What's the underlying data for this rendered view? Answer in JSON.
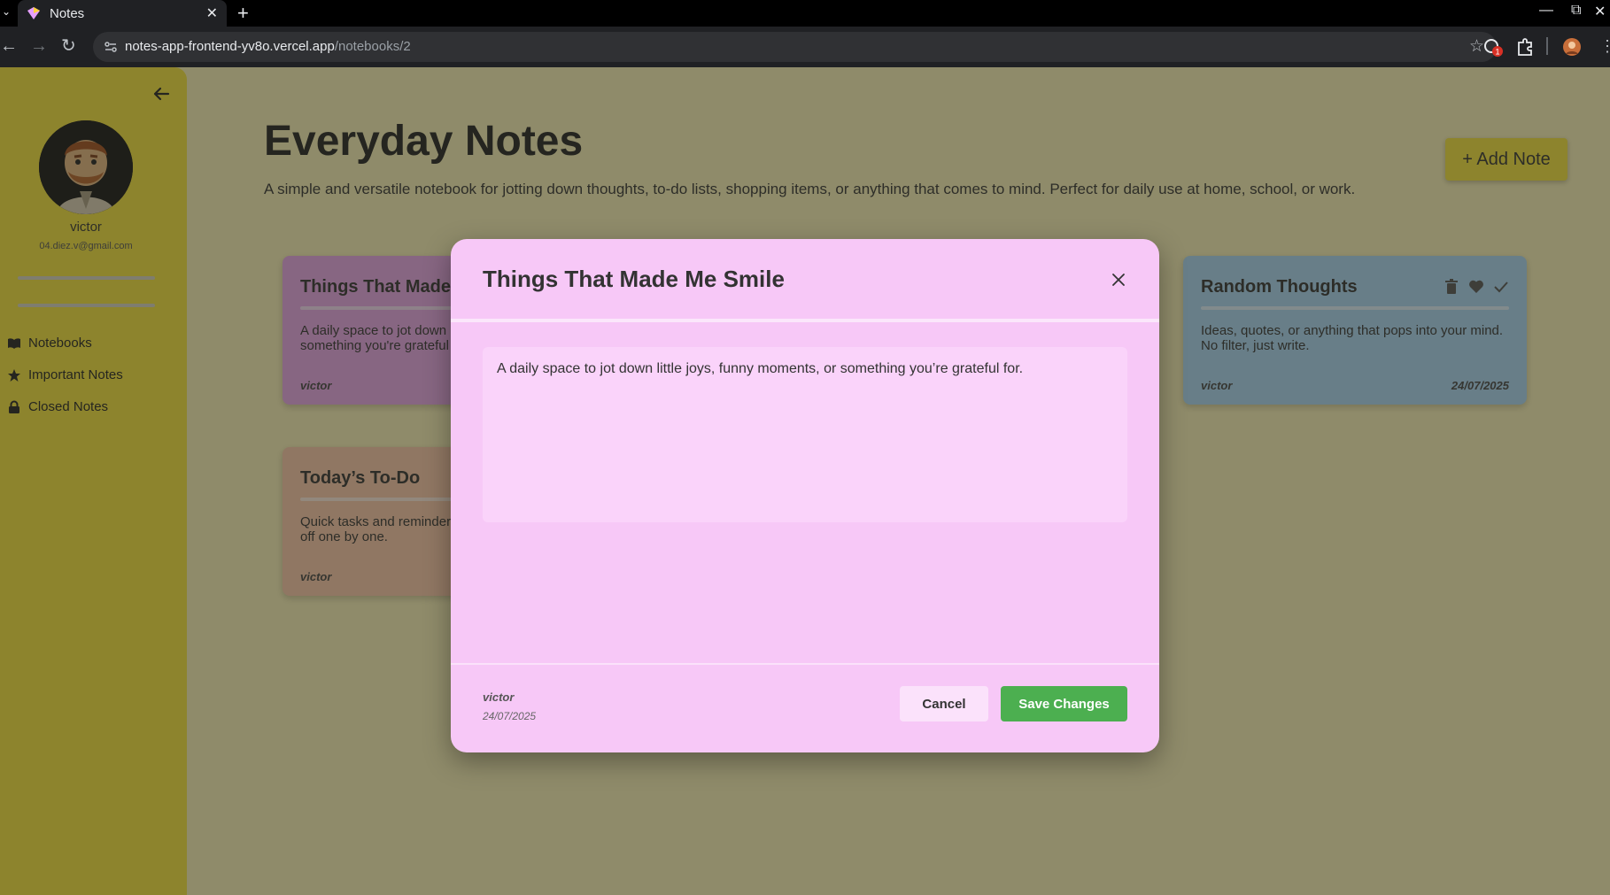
{
  "browser": {
    "tab_title": "Notes",
    "url_host": "notes-app-frontend-yv8o.vercel.app",
    "url_path": "/notebooks/2",
    "extension_badge": "1"
  },
  "sidebar": {
    "user_name": "victor",
    "user_email": "04.diez.v@gmail.com",
    "items": [
      {
        "label": "Notebooks",
        "icon": "book-icon"
      },
      {
        "label": "Important Notes",
        "icon": "star-icon"
      },
      {
        "label": "Closed Notes",
        "icon": "lock-icon"
      }
    ]
  },
  "page": {
    "title": "Everyday Notes",
    "description": "A simple and versatile notebook for jotting down thoughts, to-do lists, shopping items, or anything that comes to mind. Perfect for daily use at home, school, or work.",
    "add_note_label": "+ Add Note"
  },
  "cards": [
    {
      "title": "Things That Made Me Smile",
      "body": "A daily space to jot down little joys, funny moments, or something you're grateful for.",
      "author": "victor",
      "date": "",
      "color": "#e7a5e7"
    },
    {
      "title": "Random Thoughts",
      "body": "Ideas, quotes, or anything that pops into your mind. No filter, just write.",
      "author": "victor",
      "date": "24/07/2025",
      "color": "#a9d4f2"
    },
    {
      "title": "Today’s To-Do",
      "body": "Quick tasks and reminders to keep track. Tick them off one by one.",
      "author": "victor",
      "date": "",
      "color": "#f9c7a8"
    }
  ],
  "modal": {
    "title": "Things That Made Me Smile",
    "body": "A daily space to jot down little joys, funny moments, or something you’re grateful for.",
    "author": "victor",
    "date": "24/07/2025",
    "cancel_label": "Cancel",
    "save_label": "Save Changes"
  },
  "colors": {
    "sidebar": "#f2e13c",
    "modal_bg": "#f7c8f7",
    "save_button": "#4caf50"
  }
}
